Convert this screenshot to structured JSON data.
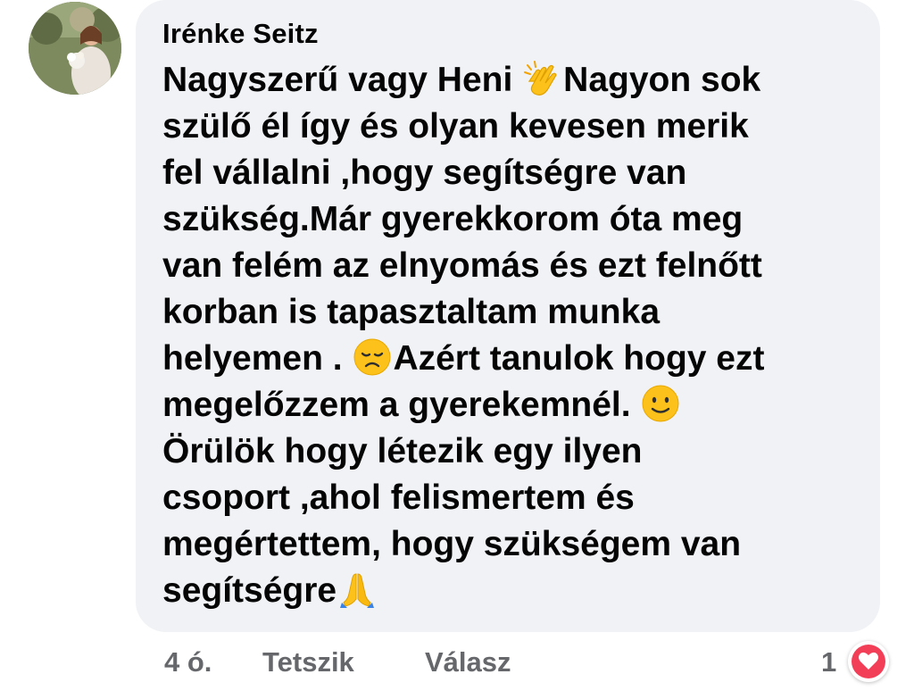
{
  "comment": {
    "author": "Irénke Seitz",
    "avatar_icon": "profile-photo-avatar",
    "lines": [
      {
        "parts": [
          "Nagyszerű vagy Heni ",
          "Nagyon sok"
        ],
        "emoji": "clapping-hands-icon"
      },
      {
        "text": "szülő él így és olyan kevesen merik"
      },
      {
        "text": "fel vállalni ,hogy segítségre van"
      },
      {
        "text": "szükség.Már gyerekkorom óta meg"
      },
      {
        "text": "van felém az elnyomás és ezt felnőtt"
      },
      {
        "text": "korban is tapasztaltam munka"
      },
      {
        "parts": [
          "helyemen . ",
          "Azért tanulok hogy ezt"
        ],
        "emoji": "disappointed-face-icon"
      },
      {
        "parts": [
          "megelőzzem a gyerekemnél. ",
          ""
        ],
        "emoji": "slightly-smiling-face-icon"
      },
      {
        "text": "Örülök hogy létezik egy ilyen"
      },
      {
        "text": "csoport ,ahol  felismertem és"
      },
      {
        "text": "megértettem, hogy szükségem van"
      },
      {
        "parts": [
          "segítségre",
          ""
        ],
        "emoji": "folded-hands-icon"
      }
    ]
  },
  "actions": {
    "time": "4 ó.",
    "like_label": "Tetszik",
    "reply_label": "Válasz",
    "reaction_count": "1",
    "reaction_icon": "heart-reaction-icon"
  },
  "colors": {
    "bubble_bg": "#f0f2f5",
    "text": "#050505",
    "secondary_text": "#65676b",
    "heart": "#f33e58"
  }
}
